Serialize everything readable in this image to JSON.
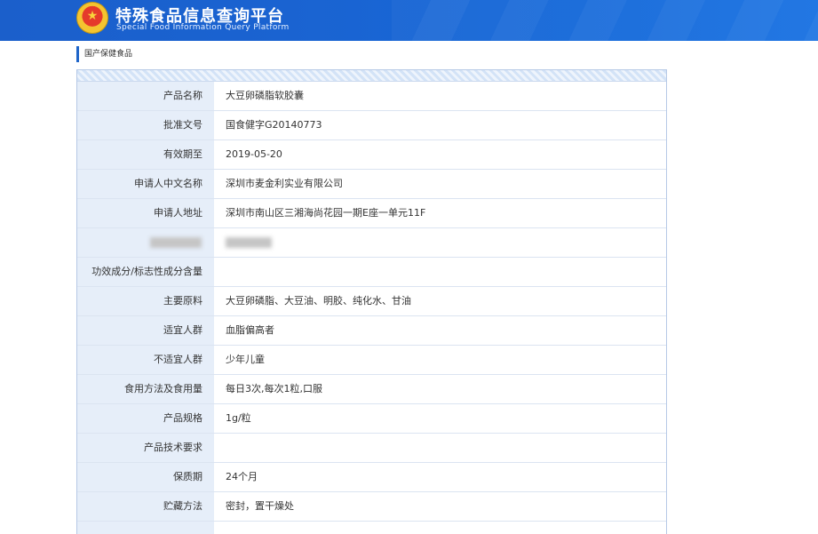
{
  "header": {
    "title_cn": "特殊食品信息查询平台",
    "title_en": "Special Food Information Query Platform",
    "emblem_icon": "national-emblem-icon"
  },
  "breadcrumb": "国产保健食品",
  "rows": [
    {
      "label": "产品名称",
      "value": "大豆卵磷脂软胶囊"
    },
    {
      "label": "批准文号",
      "value": "国食健字G20140773"
    },
    {
      "label": "有效期至",
      "value": "2019-05-20"
    },
    {
      "label": "申请人中文名称",
      "value": "深圳市麦金利实业有限公司"
    },
    {
      "label": "申请人地址",
      "value": "深圳市南山区三湘海尚花园一期E座一单元11F"
    },
    {
      "label": "",
      "value": ""
    },
    {
      "label": "功效成分/标志性成分含量",
      "value": ""
    },
    {
      "label": "主要原料",
      "value": "大豆卵磷脂、大豆油、明胶、纯化水、甘油"
    },
    {
      "label": "适宜人群",
      "value": "血脂偏高者"
    },
    {
      "label": "不适宜人群",
      "value": "少年儿童"
    },
    {
      "label": "食用方法及食用量",
      "value": "每日3次,每次1粒,口服"
    },
    {
      "label": "产品规格",
      "value": "1g/粒"
    },
    {
      "label": "产品技术要求",
      "value": ""
    },
    {
      "label": "保质期",
      "value": "24个月"
    },
    {
      "label": "贮藏方法",
      "value": "密封，置干燥处"
    }
  ],
  "colors": {
    "header_blue": "#1a63d1",
    "label_bg": "#e6eef9",
    "accent": "#1f65c9"
  }
}
